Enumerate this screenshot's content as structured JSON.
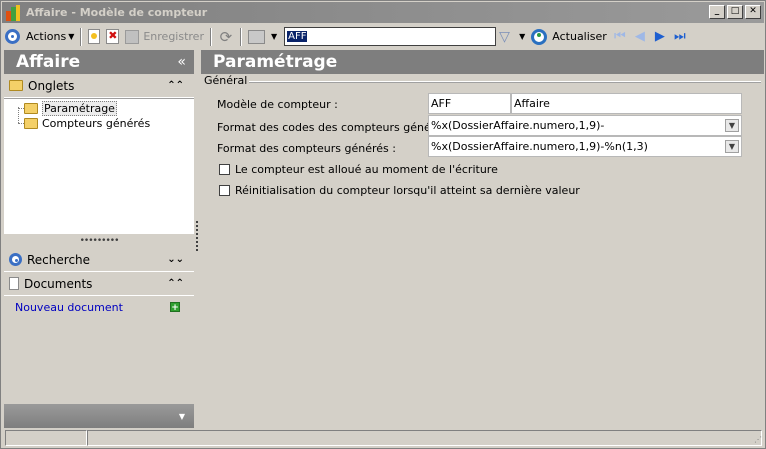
{
  "window": {
    "title": "Affaire - Modèle de compteur",
    "minimize_label": "_",
    "maximize_label": "□",
    "close_label": "✕"
  },
  "toolbar": {
    "actions_label": "Actions",
    "save_label": "Enregistrer",
    "search_value": "AFF",
    "refresh_label": "Actualiser"
  },
  "left_pane": {
    "header": "Affaire",
    "collapse_glyph": "«",
    "onglets_label": "Onglets",
    "tree_items": [
      {
        "label": "Paramétrage"
      },
      {
        "label": "Compteurs générés"
      }
    ],
    "recherche_label": "Recherche",
    "documents_label": "Documents",
    "new_document_label": "Nouveau document"
  },
  "main": {
    "title": "Paramétrage",
    "group_title": "Général",
    "fields": {
      "modele_label": "Modèle de compteur :",
      "modele_code": "AFF",
      "modele_name": "Affaire",
      "format_codes_label": "Format des codes des compteurs générés :",
      "format_codes_value": "%x(DossierAffaire.numero,1,9)-",
      "format_compteurs_label": "Format des compteurs générés :",
      "format_compteurs_value": "%x(DossierAffaire.numero,1,9)-%n(1,3)"
    },
    "checkboxes": [
      {
        "label": "Le compteur est alloué au moment de l'écriture",
        "checked": false
      },
      {
        "label": "Réinitialisation du compteur lorsqu'il atteint sa dernière valeur",
        "checked": false
      }
    ]
  },
  "icons": [
    "app-icon",
    "actions-icon",
    "new-icon",
    "delete-icon",
    "save-icon",
    "sync-icon",
    "print-icon",
    "filter-icon",
    "refresh-icon",
    "first-icon",
    "prev-icon",
    "next-icon",
    "last-icon",
    "folder-icon",
    "search-circle-icon",
    "document-icon",
    "plus-icon"
  ]
}
